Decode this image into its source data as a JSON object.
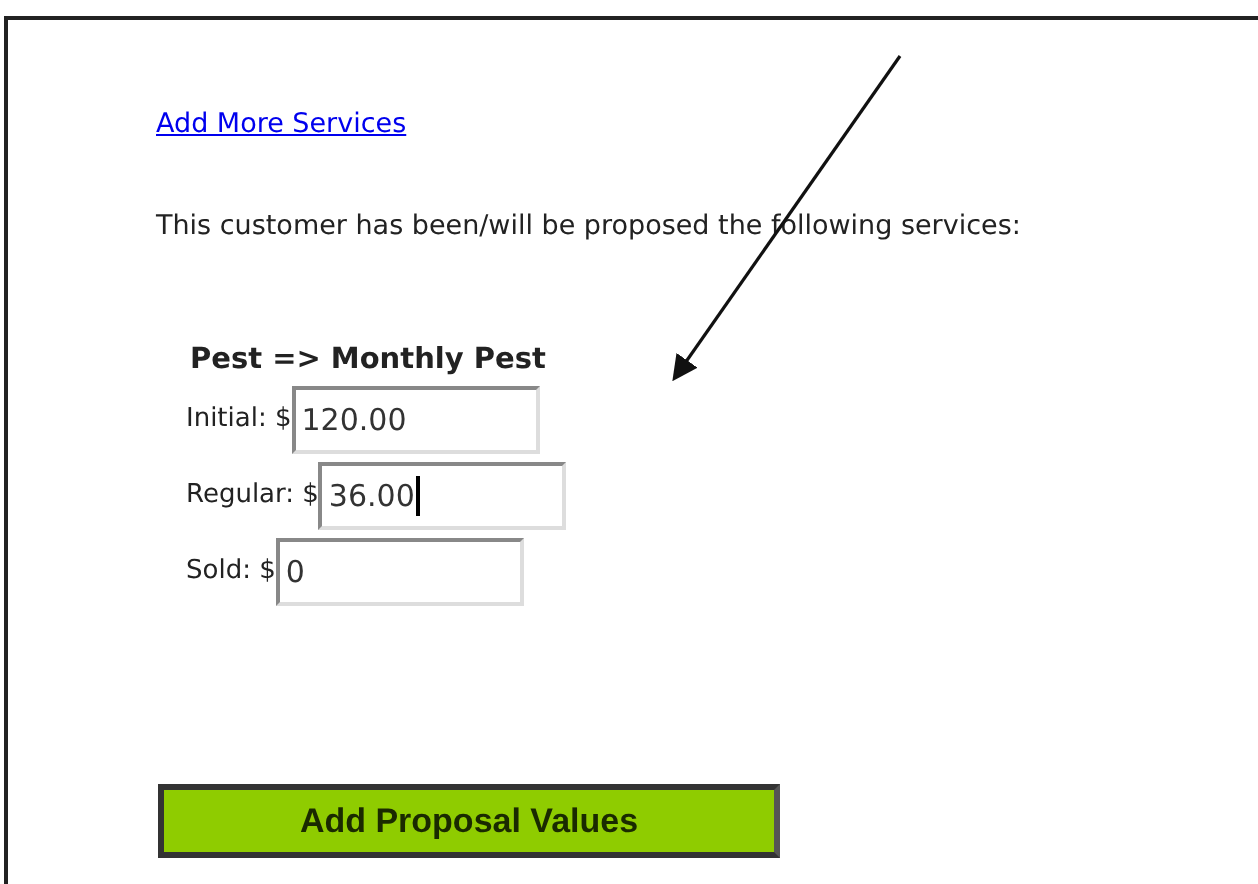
{
  "link": "Add More Services",
  "intro": "This customer has been/will be proposed the following services:",
  "service": {
    "title": "Pest => Monthly Pest",
    "fields": [
      {
        "label": "Initial: $",
        "value": "120.00",
        "focused": false
      },
      {
        "label": "Regular: $",
        "value": "36.00",
        "focused": true
      },
      {
        "label": "Sold: $",
        "value": "0",
        "focused": false
      }
    ]
  },
  "button": "Add Proposal Values"
}
